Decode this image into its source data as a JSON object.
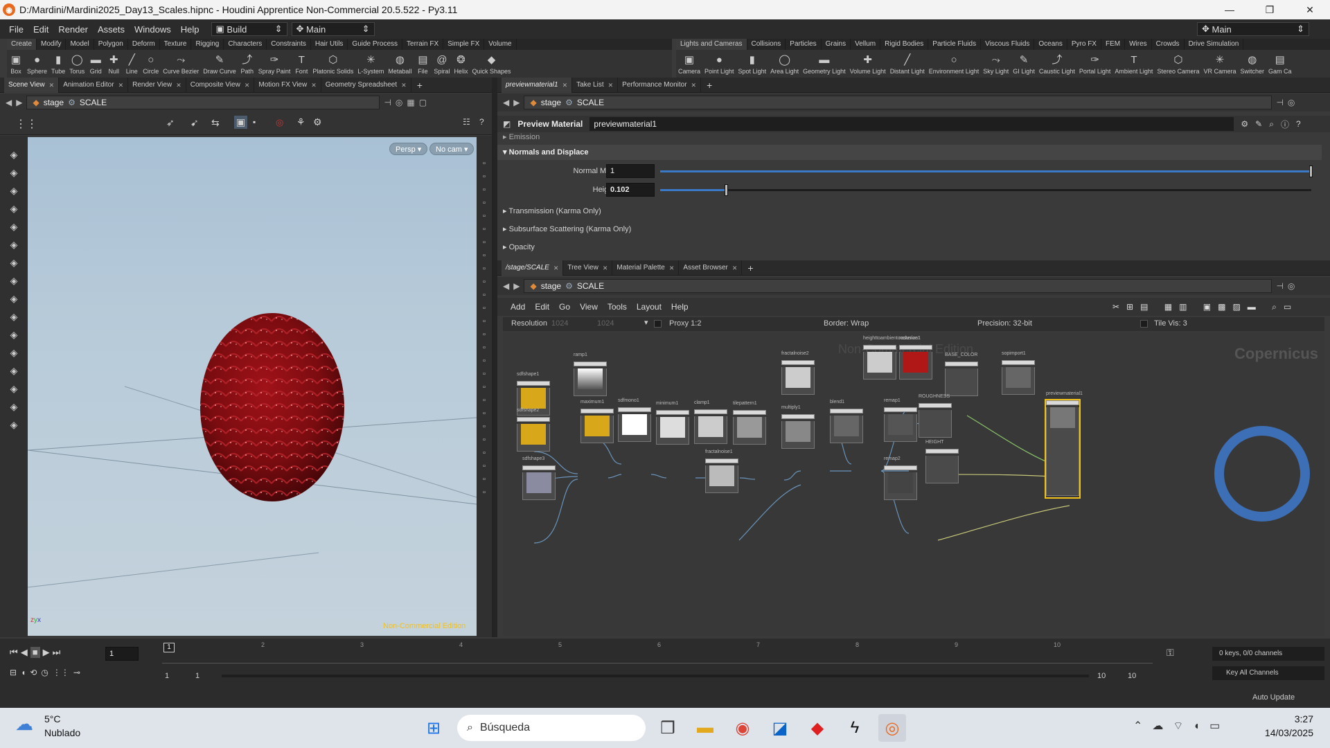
{
  "window": {
    "title": "D:/Mardini/Mardini2025_Day13_Scales.hipnc - Houdini Apprentice Non-Commercial 20.5.522 - Py3.11"
  },
  "menu": {
    "items": [
      "File",
      "Edit",
      "Render",
      "Assets",
      "Windows",
      "Help"
    ],
    "desktop": "Build",
    "layout": "Main",
    "right_layout": "Main"
  },
  "shelf_left": {
    "tabs": [
      "Create",
      "Modify",
      "Model",
      "Polygon",
      "Deform",
      "Texture",
      "Rigging",
      "Characters",
      "Constraints",
      "Hair Utils",
      "Guide Process",
      "Terrain FX",
      "Simple FX",
      "Volume"
    ],
    "tools": [
      "Box",
      "Sphere",
      "Tube",
      "Torus",
      "Grid",
      "Null",
      "Line",
      "Circle",
      "Curve Bezier",
      "Draw Curve",
      "Path",
      "Spray Paint",
      "Font",
      "Platonic Solids",
      "L-System",
      "Metaball",
      "File",
      "Spiral",
      "Helix",
      "Quick Shapes"
    ]
  },
  "shelf_right": {
    "tabs": [
      "Lights and Cameras",
      "Collisions",
      "Particles",
      "Grains",
      "Vellum",
      "Rigid Bodies",
      "Particle Fluids",
      "Viscous Fluids",
      "Oceans",
      "Pyro FX",
      "FEM",
      "Wires",
      "Crowds",
      "Drive Simulation"
    ],
    "tools": [
      "Camera",
      "Point Light",
      "Spot Light",
      "Area Light",
      "Geometry Light",
      "Volume Light",
      "Distant Light",
      "Environment Light",
      "Sky Light",
      "GI Light",
      "Caustic Light",
      "Portal Light",
      "Ambient Light",
      "Stereo Camera",
      "VR Camera",
      "Switcher",
      "Gam Ca"
    ]
  },
  "left_panel": {
    "tabs": [
      "Scene View",
      "Animation Editor",
      "Render View",
      "Composite View",
      "Motion FX View",
      "Geometry Spreadsheet"
    ],
    "path_stage": "stage",
    "path_node": "SCALE",
    "viewport": {
      "persp": "Persp",
      "cam": "No cam",
      "watermark": "Non-Commercial Edition"
    }
  },
  "param_panel": {
    "tabs": [
      "previewmaterial1",
      "Take List",
      "Performance Monitor"
    ],
    "path_stage": "stage",
    "path_node": "SCALE",
    "node_type": "Preview Material",
    "node_name": "previewmaterial1",
    "sections": {
      "emission": "Emission",
      "normals": "Normals and Displace",
      "transmission": "Transmission (Karma Only)",
      "sss": "Subsurface Scattering (Karma Only)",
      "opacity": "Opacity"
    },
    "params": [
      {
        "label": "Normal Map Scale",
        "value": "1",
        "fraction": 1.0
      },
      {
        "label": "Height Scale",
        "value": "0.102",
        "fraction": 0.102
      }
    ]
  },
  "network_panel": {
    "tabs": [
      "/stage/SCALE",
      "Tree View",
      "Material Palette",
      "Asset Browser"
    ],
    "path_stage": "stage",
    "path_node": "SCALE",
    "menu": [
      "Add",
      "Edit",
      "Go",
      "View",
      "Tools",
      "Layout",
      "Help"
    ],
    "opts": {
      "resolution_label": "Resolution",
      "res_x": "1024",
      "res_y": "1024",
      "proxy": "Proxy 1:2",
      "border": "Border: Wrap",
      "precision": "Precision: 32-bit",
      "tilevis": "Tile Vis: 3"
    },
    "watermark": "Non-Commercial Edition",
    "context": "Copernicus",
    "nodes": [
      "sdfshape1",
      "sdfshape2",
      "sdfshape3",
      "ramp1",
      "maximum1",
      "sdfmono1",
      "minimum1",
      "clamp1",
      "tilepattern1",
      "fractalnoise1",
      "fractalnoise2",
      "multiply1",
      "blend1",
      "remap1",
      "remap2",
      "heighttoambientocclusion1",
      "rasterize1",
      "BASE_COLOR",
      "ROUGHNESS",
      "HEIGHT",
      "sopimport1",
      "previewmaterial1"
    ]
  },
  "timeline": {
    "frame": "1",
    "ticks": [
      "1",
      "2",
      "3",
      "4",
      "5",
      "6",
      "7",
      "8",
      "9",
      "10"
    ],
    "range_start": "1",
    "range_start2": "1",
    "range_end": "10",
    "range_end2": "10",
    "keys": "0 keys, 0/0 channels",
    "key_all": "Key All Channels",
    "auto_update": "Auto Update"
  },
  "taskbar": {
    "temp": "5°C",
    "weather": "Nublado",
    "search": "Búsqueda",
    "time": "3:27",
    "date": "14/03/2025"
  }
}
